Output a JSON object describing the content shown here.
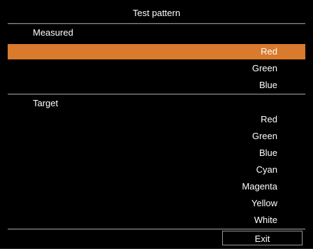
{
  "menu": {
    "title": "Test pattern",
    "measured": {
      "label": "Measured",
      "items": [
        {
          "label": "Red",
          "selected": true
        },
        {
          "label": "Green",
          "selected": false
        },
        {
          "label": "Blue",
          "selected": false
        }
      ]
    },
    "target": {
      "label": "Target",
      "items": [
        {
          "label": "Red"
        },
        {
          "label": "Green"
        },
        {
          "label": "Blue"
        },
        {
          "label": "Cyan"
        },
        {
          "label": "Magenta"
        },
        {
          "label": "Yellow"
        },
        {
          "label": "White"
        }
      ]
    },
    "exit_label": "Exit"
  },
  "colors": {
    "background": "#000000",
    "highlight": "#d97a2d",
    "text": "#ffffff",
    "divider": "#8a8a8a"
  }
}
